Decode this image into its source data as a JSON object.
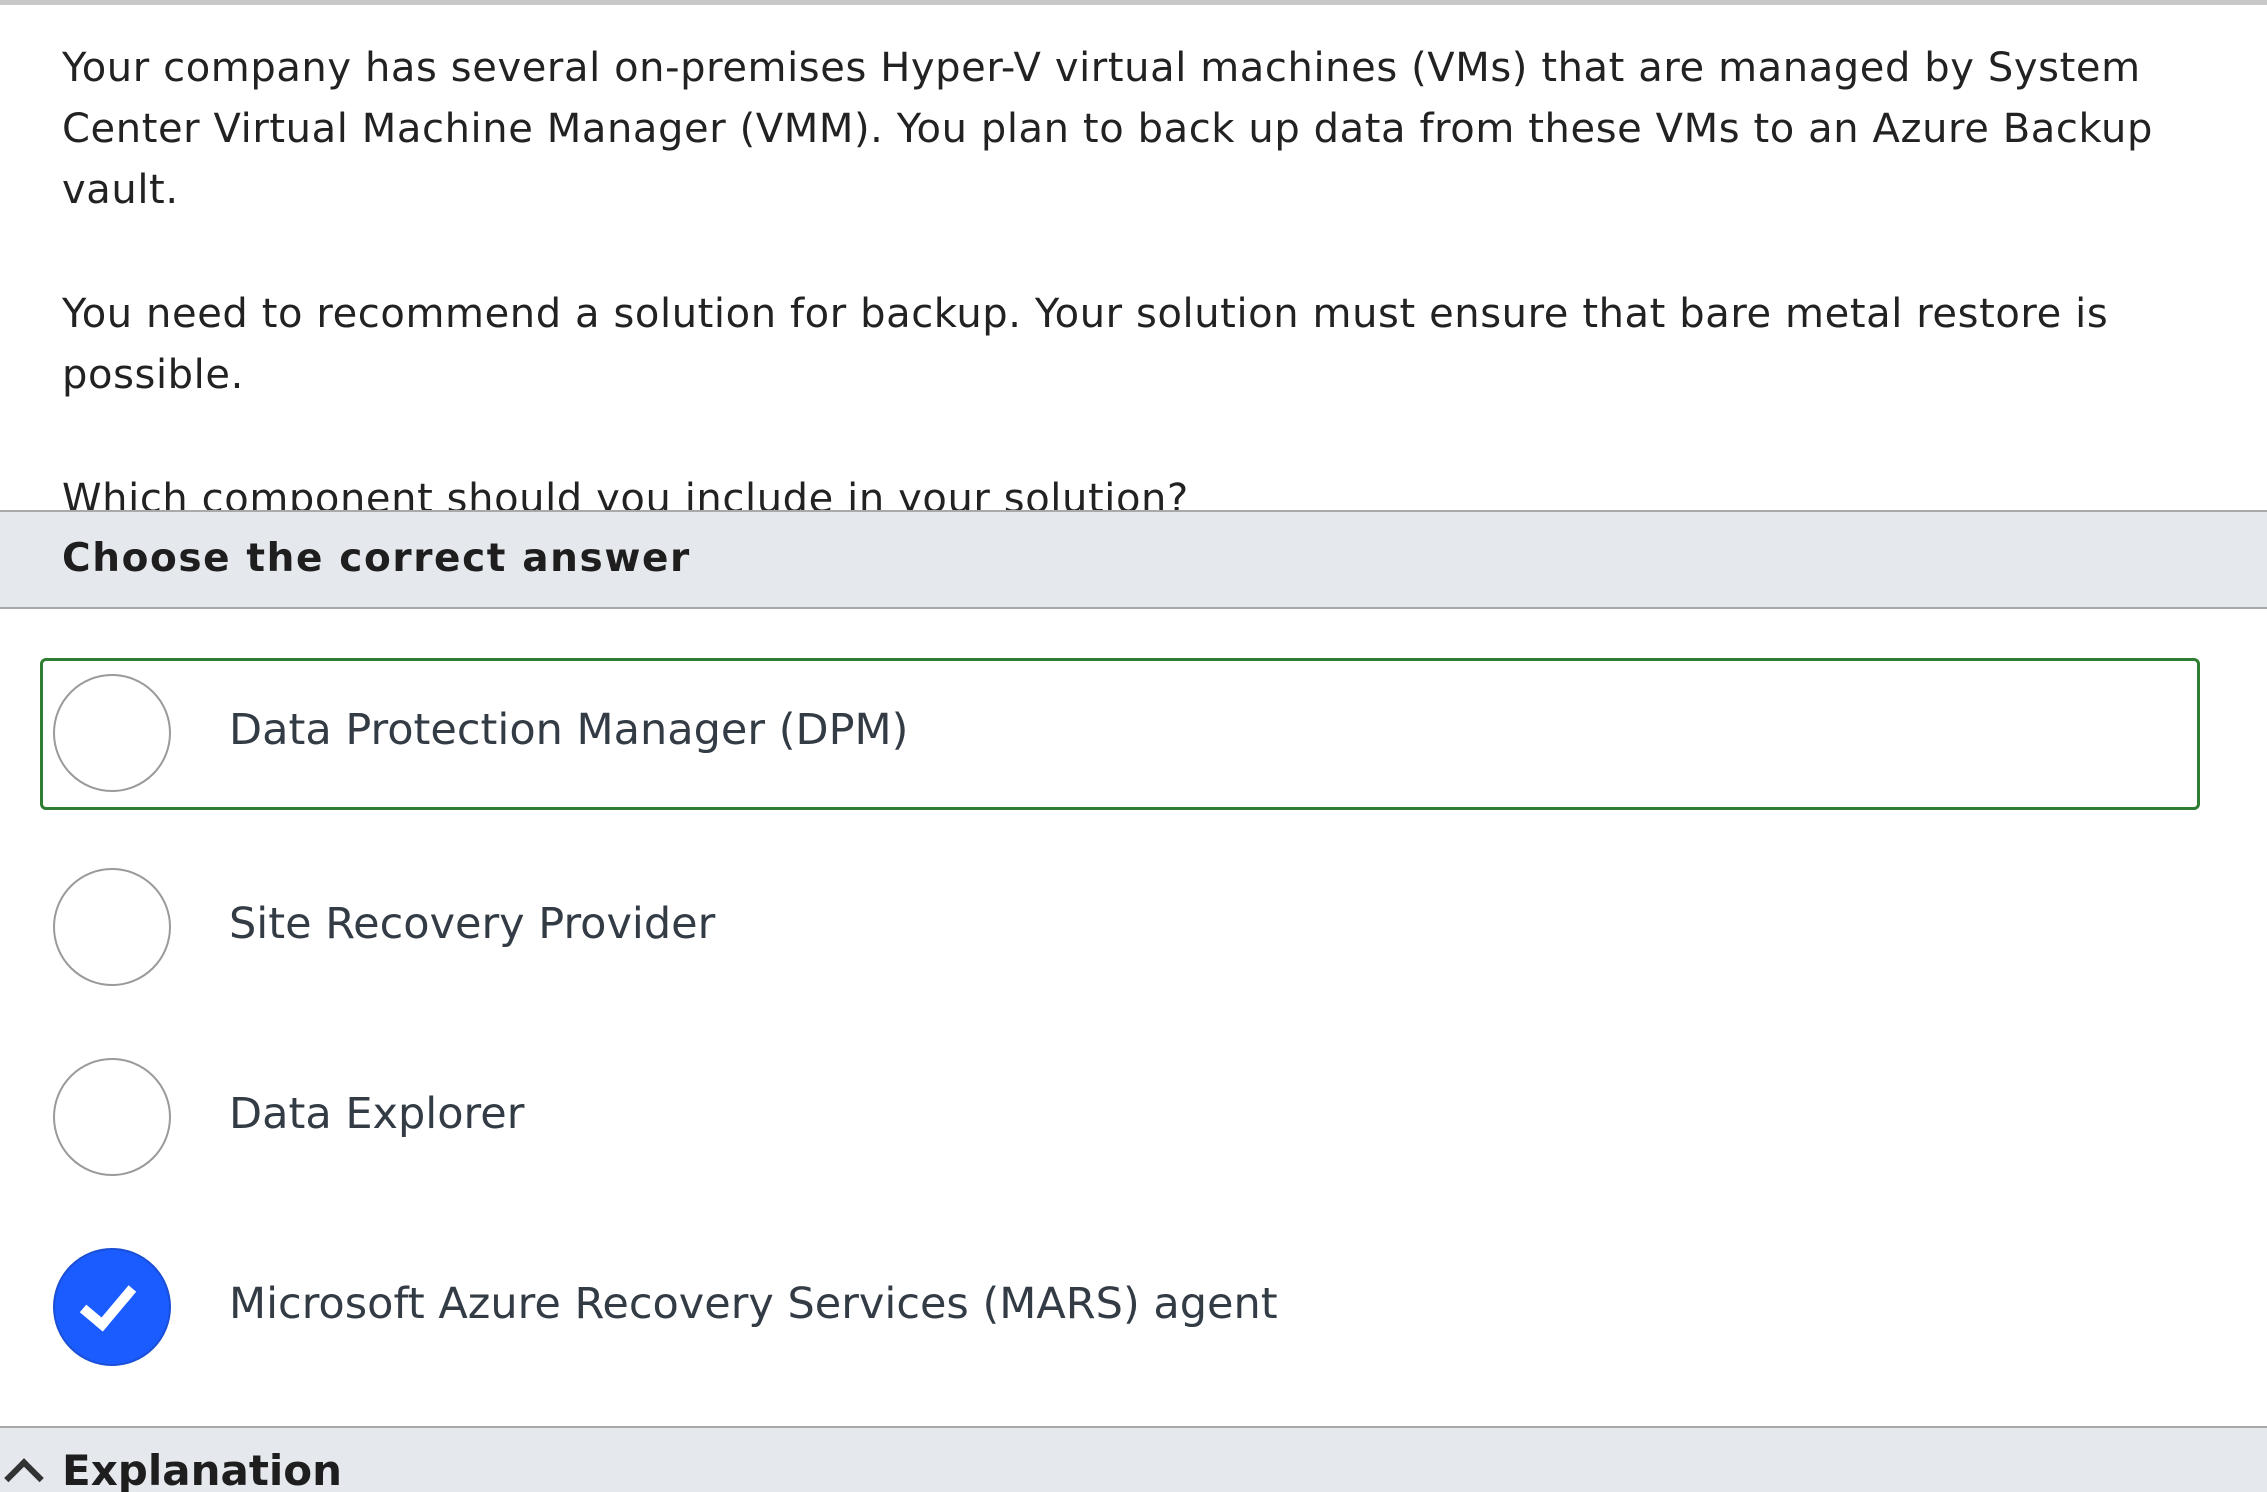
{
  "question": {
    "paragraphs": [
      "Your company has several on-premises Hyper-V virtual machines (VMs) that are managed by System Center Virtual Machine Manager (VMM). You plan to back up data from these VMs to an Azure Backup vault.",
      "You need to recommend a solution for backup. Your solution must ensure that bare metal restore is possible.",
      "Which component should you include in your solution?"
    ]
  },
  "answer_section": {
    "header": "Choose the correct answer"
  },
  "options": [
    {
      "label": "Data Protection Manager (DPM)",
      "selected": false,
      "highlighted": true
    },
    {
      "label": "Site Recovery Provider",
      "selected": false,
      "highlighted": false
    },
    {
      "label": "Data Explorer",
      "selected": false,
      "highlighted": false
    },
    {
      "label": "Microsoft Azure Recovery Services (MARS) agent",
      "selected": true,
      "highlighted": false
    }
  ],
  "explanation": {
    "label": "Explanation",
    "toggle_icon": "chevron-up-icon"
  },
  "colors": {
    "highlight_border": "#2e7d32",
    "selected_radio": "#1a5cff",
    "header_background": "#e5e9ed"
  }
}
